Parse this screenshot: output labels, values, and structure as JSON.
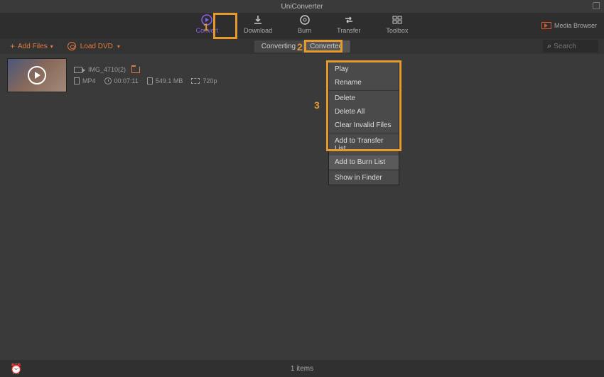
{
  "app_title": "UniConverter",
  "main_tabs": {
    "convert": "Convert",
    "download": "Download",
    "burn": "Burn",
    "transfer": "Transfer",
    "toolbox": "Toolbox"
  },
  "media_browser": "Media Browser",
  "toolbar": {
    "add_files": "Add Files",
    "load_dvd": "Load DVD"
  },
  "sub_tabs": {
    "converting": "Converting",
    "converted": "Converted"
  },
  "search": {
    "placeholder": "Search"
  },
  "file": {
    "name": "IMG_4710(2)",
    "format": "MP4",
    "duration": "00:07:11",
    "size": "549.1 MB",
    "resolution": "720p"
  },
  "context_menu": {
    "play": "Play",
    "rename": "Rename",
    "delete": "Delete",
    "delete_all": "Delete All",
    "clear_invalid": "Clear Invalid Files",
    "add_transfer": "Add to Transfer List",
    "add_burn": "Add to Burn List",
    "show_finder": "Show in Finder"
  },
  "status": {
    "items": "1 items"
  },
  "annotations": {
    "n1": "1",
    "n2": "2",
    "n3": "3"
  },
  "colors": {
    "accent": "#8a5cf0",
    "orange": "#e07b3d",
    "highlight": "#e69a2e"
  }
}
